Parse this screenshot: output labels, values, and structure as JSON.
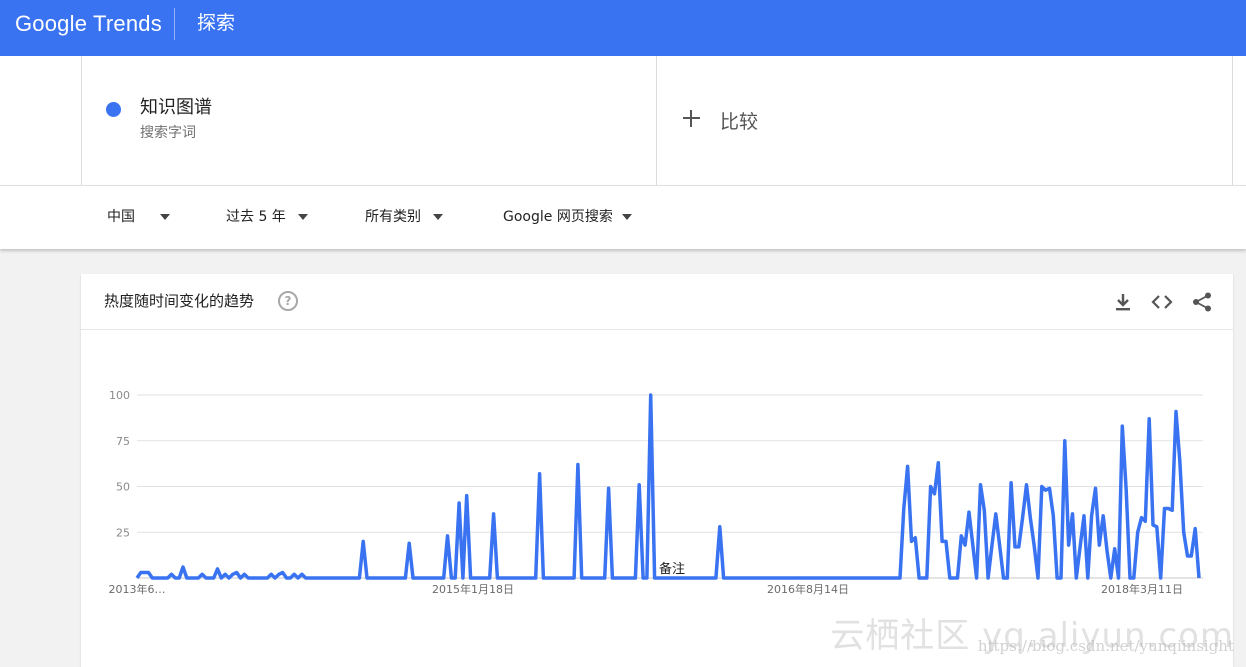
{
  "header": {
    "logo": "Google Trends",
    "search_label": "探索"
  },
  "term": {
    "name": "知识图谱",
    "sub": "搜索字词",
    "color": "#3a73f1"
  },
  "compare": {
    "label": "比较"
  },
  "filters": [
    {
      "label": "中国"
    },
    {
      "label": "过去 5 年"
    },
    {
      "label": "所有类别"
    },
    {
      "label": "Google 网页搜索"
    }
  ],
  "card": {
    "title": "热度随时间变化的趋势",
    "help_icon": "help-circle-icon",
    "tools": [
      "download-icon",
      "embed-code-icon",
      "share-icon"
    ]
  },
  "watermark": {
    "big": "云栖社区 yq.aliyun.com",
    "small": "https://blog.csdn.net/yunqiinsight"
  },
  "chart_data": {
    "type": "line",
    "ylim": [
      0,
      100
    ],
    "yticks": [
      100,
      75,
      50,
      25
    ],
    "xticks": [
      "2013年6…",
      "2015年1月18日",
      "2016年8月14日",
      "2018年3月11日"
    ],
    "annotation": "备注",
    "grid": true,
    "series": [
      {
        "color": "#3a73f1",
        "values": [
          0,
          3,
          3,
          3,
          0,
          0,
          0,
          0,
          0,
          2,
          0,
          0,
          6,
          0,
          0,
          0,
          0,
          2,
          0,
          0,
          0,
          5,
          0,
          2,
          0,
          2,
          3,
          0,
          2,
          0,
          0,
          0,
          0,
          0,
          0,
          2,
          0,
          2,
          3,
          0,
          0,
          2,
          0,
          2,
          0,
          0,
          0,
          0,
          0,
          0,
          0,
          0,
          0,
          0,
          0,
          0,
          0,
          0,
          0,
          20,
          0,
          0,
          0,
          0,
          0,
          0,
          0,
          0,
          0,
          0,
          0,
          19,
          0,
          0,
          0,
          0,
          0,
          0,
          0,
          0,
          0,
          23,
          0,
          0,
          41,
          0,
          45,
          0,
          0,
          0,
          0,
          0,
          0,
          35,
          0,
          0,
          0,
          0,
          0,
          0,
          0,
          0,
          0,
          0,
          0,
          57,
          0,
          0,
          0,
          0,
          0,
          0,
          0,
          0,
          0,
          62,
          0,
          0,
          0,
          0,
          0,
          0,
          0,
          49,
          0,
          0,
          0,
          0,
          0,
          0,
          0,
          51,
          0,
          0,
          100,
          0,
          0,
          0,
          0,
          0,
          0,
          0,
          0,
          0,
          0,
          0,
          0,
          0,
          0,
          0,
          0,
          0,
          28,
          0,
          0,
          0,
          0,
          0,
          0,
          0,
          0,
          0,
          0,
          0,
          0,
          0,
          0,
          0,
          0,
          0,
          0,
          0,
          0,
          0,
          0,
          0,
          0,
          0,
          0,
          0,
          0,
          0,
          0,
          0,
          0,
          0,
          0,
          0,
          0,
          0,
          0,
          0,
          0,
          0,
          0,
          0,
          0,
          0,
          0,
          0,
          38,
          61,
          20,
          22,
          0,
          0,
          0,
          50,
          46,
          63,
          20,
          20,
          0,
          0,
          0,
          23,
          18,
          36,
          18,
          0,
          51,
          37,
          0,
          18,
          35,
          18,
          0,
          0,
          52,
          17,
          17,
          33,
          51,
          33,
          18,
          0,
          50,
          48,
          49,
          34,
          0,
          0,
          75,
          18,
          35,
          0,
          17,
          34,
          0,
          34,
          49,
          18,
          34,
          15,
          0,
          16,
          0,
          83,
          48,
          0,
          0,
          25,
          33,
          31,
          87,
          29,
          28,
          0,
          38,
          38,
          37,
          91,
          64,
          25,
          12,
          12,
          27,
          0
        ]
      }
    ]
  }
}
